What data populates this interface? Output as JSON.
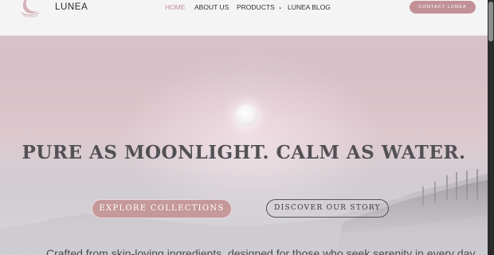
{
  "brand": {
    "name": "LUNEA",
    "logo_icon": "crescent-moon-logo-icon"
  },
  "nav": {
    "items": [
      {
        "label": "HOME",
        "active": true
      },
      {
        "label": "ABOUT US",
        "active": false
      },
      {
        "label": "PRODUCTS",
        "active": false,
        "dropdown": true,
        "icon": "chevron-down-icon"
      },
      {
        "label": "LUNEA BLOG",
        "active": false
      }
    ],
    "dropdown_glyph": "⌄",
    "contact_label": "CONTACT LUNEA"
  },
  "hero": {
    "headline": "PURE AS MOONLIGHT. CALM AS WATER.",
    "primary_cta": "EXPLORE COLLECTIONS",
    "secondary_cta": "DISCOVER OUR STORY",
    "subtext": "Crafted from skin-loving ingredients, designed for those who seek serenity in every day"
  },
  "colors": {
    "accent": "#c29197",
    "active_nav": "#c58d96",
    "headline": "#535155",
    "header_bg": "#f5f4f5"
  }
}
